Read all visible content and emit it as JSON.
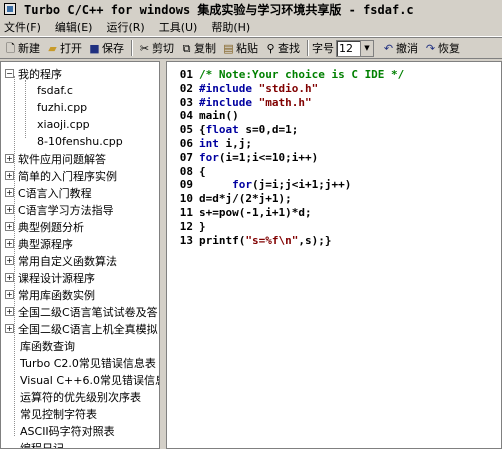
{
  "window": {
    "title": "Turbo C/C++ for windows 集成实验与学习环境共享版 - fsdaf.c"
  },
  "menu": [
    "文件(F)",
    "编辑(E)",
    "运行(R)",
    "工具(U)",
    "帮助(H)"
  ],
  "toolbar": {
    "new_label": "新建",
    "open_label": "打开",
    "save_label": "保存",
    "cut_label": "剪切",
    "copy_label": "复制",
    "paste_label": "粘贴",
    "find_label": "查找",
    "font_size_label": "字号",
    "font_size_value": "12",
    "undo_label": "撤消",
    "redo_label": "恢复"
  },
  "tree": {
    "root_label": "我的程序",
    "files": [
      "fsdaf.c",
      "fuzhi.cpp",
      "xiaoji.cpp",
      "8-10fenshu.cpp"
    ],
    "folders": [
      "软件应用问题解答",
      "简单的入门程序实例",
      "C语言入门教程",
      "C语言学习方法指导",
      "典型例题分析",
      "典型源程序",
      "常用自定义函数算法",
      "课程设计源程序",
      "常用库函数实例",
      "全国二级C语言笔试试卷及答",
      "全国二级C语言上机全真模拟"
    ],
    "items": [
      "库函数查询",
      "Turbo C2.0常见错误信息表",
      "Visual C++6.0常见错误信息",
      "运算符的优先级别次序表",
      "常见控制字符表",
      "ASCII码字符对照表",
      "编程日记"
    ]
  },
  "code": [
    {
      "n": "01",
      "parts": [
        {
          "c": "cm",
          "t": "/* Note:Your choice is C IDE */"
        }
      ]
    },
    {
      "n": "02",
      "parts": [
        {
          "c": "kw",
          "t": "#include "
        },
        {
          "c": "str",
          "t": "\"stdio.h\""
        }
      ]
    },
    {
      "n": "03",
      "parts": [
        {
          "c": "kw",
          "t": "#include "
        },
        {
          "c": "str",
          "t": "\"math.h\""
        }
      ]
    },
    {
      "n": "04",
      "parts": [
        {
          "c": "tx",
          "t": "main()"
        }
      ]
    },
    {
      "n": "05",
      "parts": [
        {
          "c": "tx",
          "t": "{"
        },
        {
          "c": "kw",
          "t": "float"
        },
        {
          "c": "tx",
          "t": " s=0,d=1;"
        }
      ]
    },
    {
      "n": "06",
      "parts": [
        {
          "c": "kw",
          "t": "int"
        },
        {
          "c": "tx",
          "t": " i,j;"
        }
      ]
    },
    {
      "n": "07",
      "parts": [
        {
          "c": "kw",
          "t": "for"
        },
        {
          "c": "tx",
          "t": "(i=1;i<=10;i++)"
        }
      ]
    },
    {
      "n": "08",
      "parts": [
        {
          "c": "tx",
          "t": "{"
        }
      ]
    },
    {
      "n": "09",
      "parts": [
        {
          "c": "tx",
          "t": "     "
        },
        {
          "c": "kw",
          "t": "for"
        },
        {
          "c": "tx",
          "t": "(j=i;j<i+1;j++)"
        }
      ]
    },
    {
      "n": "10",
      "parts": [
        {
          "c": "tx",
          "t": "d=d*j/(2*j+1);"
        }
      ]
    },
    {
      "n": "11",
      "parts": [
        {
          "c": "tx",
          "t": "s+=pow(-1,i+1)*d;"
        }
      ]
    },
    {
      "n": "12",
      "parts": [
        {
          "c": "tx",
          "t": "}"
        }
      ]
    },
    {
      "n": "13",
      "parts": [
        {
          "c": "tx",
          "t": "printf("
        },
        {
          "c": "str",
          "t": "\"s=%f\\n\""
        },
        {
          "c": "tx",
          "t": ",s);}"
        }
      ]
    }
  ]
}
